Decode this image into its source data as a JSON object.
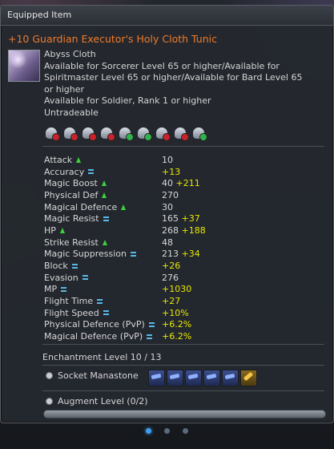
{
  "window": {
    "title": "Equipped Item"
  },
  "item": {
    "name": "+10 Guardian Executor's Holy Cloth Tunic",
    "type": "Abyss Cloth",
    "requirements": [
      "Available for Sorcerer Level 65 or higher/Available for",
      "Spiritmaster Level 65 or higher/Available for Bard Level 65",
      "or higher"
    ],
    "rank_requirement": "Available for Soldier, Rank 1 or higher",
    "trade_status": "Untradeable",
    "class_icons": [
      {
        "name": "gladiator-class-icon",
        "state": "unavailable"
      },
      {
        "name": "templar-class-icon",
        "state": "unavailable"
      },
      {
        "name": "assassin-class-icon",
        "state": "unavailable"
      },
      {
        "name": "ranger-class-icon",
        "state": "unavailable"
      },
      {
        "name": "sorcerer-class-icon",
        "state": "available"
      },
      {
        "name": "spiritmaster-class-icon",
        "state": "available"
      },
      {
        "name": "cleric-class-icon",
        "state": "unavailable"
      },
      {
        "name": "chanter-class-icon",
        "state": "unavailable"
      },
      {
        "name": "bard-class-icon",
        "state": "available"
      }
    ]
  },
  "stats": [
    {
      "label": "Attack",
      "indicator": "up",
      "value": "10",
      "bonus": ""
    },
    {
      "label": "Accuracy",
      "indicator": "equal",
      "value": "",
      "bonus": "+13"
    },
    {
      "label": "Magic Boost",
      "indicator": "up",
      "value": "40",
      "bonus": "+211"
    },
    {
      "label": "Physical Def",
      "indicator": "up",
      "value": "270",
      "bonus": ""
    },
    {
      "label": "Magical Defence",
      "indicator": "up",
      "value": "30",
      "bonus": ""
    },
    {
      "label": "Magic Resist",
      "indicator": "equal",
      "value": "165",
      "bonus": "+37"
    },
    {
      "label": "HP",
      "indicator": "up",
      "value": "268",
      "bonus": "+188"
    },
    {
      "label": "Strike Resist",
      "indicator": "up",
      "value": "48",
      "bonus": ""
    },
    {
      "label": "Magic Suppression",
      "indicator": "equal",
      "value": "213",
      "bonus": "+34"
    },
    {
      "label": "Block",
      "indicator": "equal",
      "value": "",
      "bonus": "+26"
    },
    {
      "label": "Evasion",
      "indicator": "equal",
      "value": "276",
      "bonus": ""
    },
    {
      "label": "MP",
      "indicator": "equal",
      "value": "",
      "bonus": "+1030"
    },
    {
      "label": "Flight Time",
      "indicator": "equal",
      "value": "",
      "bonus": "+27"
    },
    {
      "label": "Flight Speed",
      "indicator": "equal",
      "value": "",
      "bonus": "+10%"
    },
    {
      "label": "Physical Defence (PvP)",
      "indicator": "equal",
      "value": "",
      "bonus": "+6.2%"
    },
    {
      "label": "Magical Defence (PvP)",
      "indicator": "equal",
      "value": "",
      "bonus": "+6.2%"
    }
  ],
  "enchantment": {
    "label": "Enchantment Level 10 / 13"
  },
  "socket": {
    "label": "Socket Manastone",
    "stones": [
      "blue",
      "blue",
      "blue",
      "blue",
      "blue",
      "gold"
    ]
  },
  "augment": {
    "label": "Augment Level (0/2)",
    "progress": 0
  },
  "pager": {
    "pages": 3,
    "current": 1
  }
}
